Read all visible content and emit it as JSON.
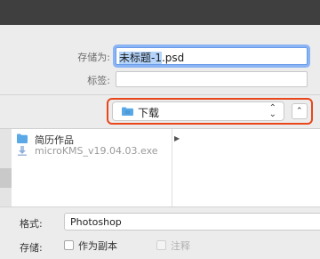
{
  "form": {
    "save_as_label": "存储为:",
    "file_name_selected": "未标题-1",
    "file_name_ext": ".psd",
    "tags_label": "标签:",
    "tags_value": ""
  },
  "location": {
    "folder_name": "下载"
  },
  "browser": {
    "items": [
      {
        "name": "简历作品",
        "type": "folder"
      },
      {
        "name": "microKMS_v19.04.03.exe",
        "type": "file"
      }
    ]
  },
  "options": {
    "format_label": "格式:",
    "format_value": "Photoshop",
    "save_label": "存储:",
    "as_copy_label": "作为副本",
    "notes_label": "注释"
  },
  "colors": {
    "accent": "#8ab4f4",
    "highlight": "#e8471c",
    "folder": "#5aa9e6"
  }
}
